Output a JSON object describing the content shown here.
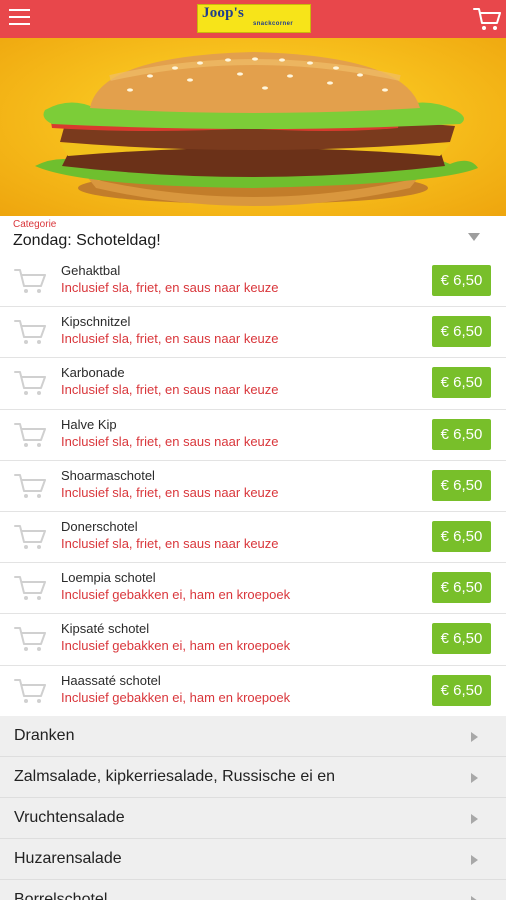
{
  "header": {
    "logo_main": "Joop's",
    "logo_sub": "snackcorner",
    "brand_color": "#e8474b"
  },
  "hero": {
    "image": "hamburger-photo"
  },
  "category": {
    "label": "Categorie",
    "value": "Zondag: Schoteldag!"
  },
  "items": [
    {
      "name": "Gehaktbal",
      "description": "Inclusief sla, friet, en saus naar keuze",
      "price": "€ 6,50"
    },
    {
      "name": "Kipschnitzel",
      "description": "Inclusief sla, friet, en saus naar keuze",
      "price": "€ 6,50"
    },
    {
      "name": "Karbonade",
      "description": "Inclusief sla, friet, en saus naar keuze",
      "price": "€ 6,50"
    },
    {
      "name": "Halve Kip",
      "description": "Inclusief sla, friet, en saus naar keuze",
      "price": "€ 6,50"
    },
    {
      "name": "Shoarmaschotel",
      "description": "Inclusief sla, friet, en saus naar keuze",
      "price": "€ 6,50"
    },
    {
      "name": "Donerschotel",
      "description": "Inclusief sla, friet, en saus naar keuze",
      "price": "€ 6,50"
    },
    {
      "name": "Loempia schotel",
      "description": "Inclusief gebakken ei, ham en kroepoek",
      "price": "€ 6,50"
    },
    {
      "name": "Kipsaté schotel",
      "description": "Inclusief gebakken ei, ham en kroepoek",
      "price": "€ 6,50"
    },
    {
      "name": "Haassaté schotel",
      "description": "Inclusief gebakken ei, ham en kroepoek",
      "price": "€ 6,50"
    }
  ],
  "categories": [
    {
      "label": "Dranken"
    },
    {
      "label": "Zalmsalade, kipkerriesalade, Russische ei en"
    },
    {
      "label": "Vruchtensalade"
    },
    {
      "label": "Huzarensalade"
    },
    {
      "label": "Borrelschotel"
    }
  ],
  "colors": {
    "price_green": "#78bf2a",
    "accent_red": "#d9363b"
  }
}
